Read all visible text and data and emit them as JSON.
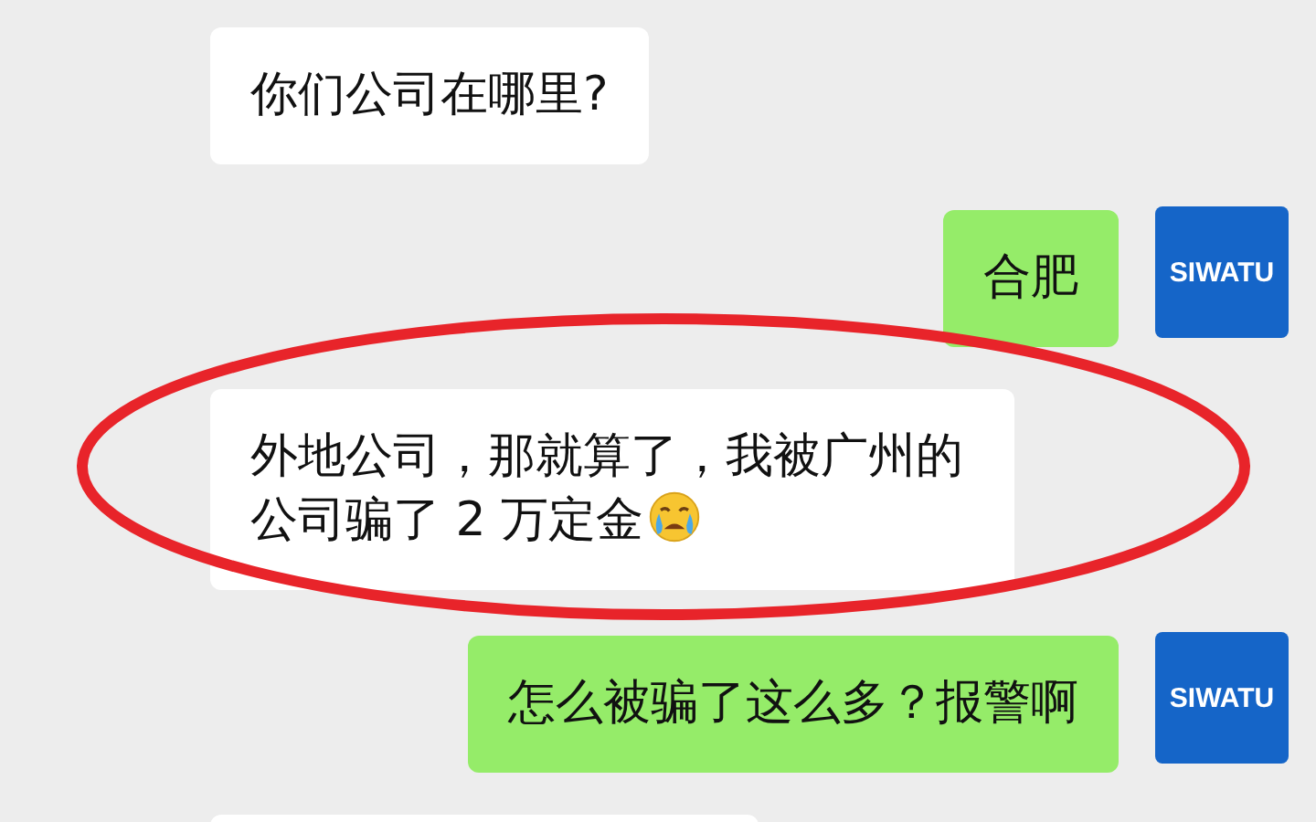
{
  "messages": [
    {
      "kind": "received",
      "text": "你们公司在哪里?"
    },
    {
      "kind": "sent",
      "text": "合肥",
      "avatar": "SIWATU"
    },
    {
      "kind": "received",
      "text": "外地公司，那就算了，我被广州的公司骗了 2 万定金",
      "emoji": {
        "kind": "crying"
      }
    },
    {
      "kind": "sent",
      "text": "怎么被骗了这么多？报警啊",
      "avatar": "SIWATU"
    },
    {
      "kind": "received"
    }
  ],
  "highlight": {
    "kind": "ellipse",
    "color": "#e8242a"
  }
}
